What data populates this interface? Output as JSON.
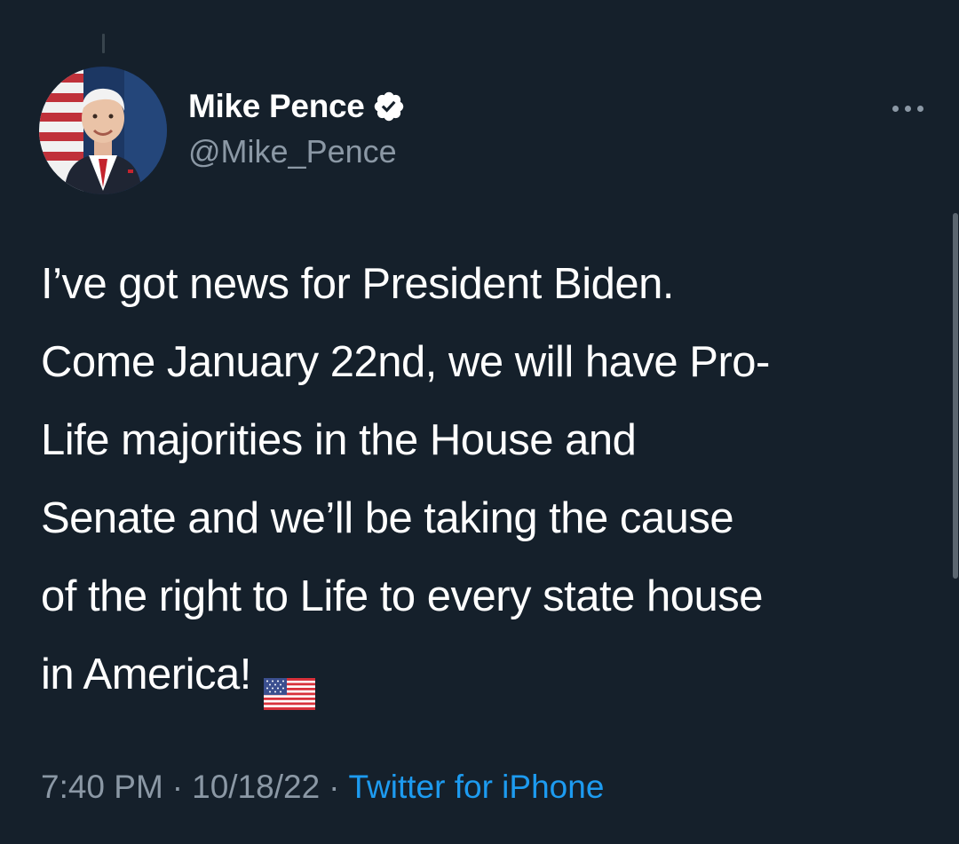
{
  "author": {
    "display_name": "Mike Pence",
    "handle": "@Mike_Pence",
    "verified": true
  },
  "tweet": {
    "text_lines": [
      "I’ve got news for President Biden.",
      "Come January 22nd, we will have Pro-",
      "Life majorities in the House and",
      "Senate and we’ll be taking the cause",
      "of the right to Life to every state house",
      "in America!"
    ],
    "time": "7:40 PM",
    "date": "10/18/22",
    "separator": "·",
    "source": "Twitter for iPhone"
  },
  "icons": {
    "more": "more-horizontal-icon",
    "verified": "verified-badge-icon",
    "emoji": "us-flag-emoji"
  },
  "colors": {
    "background": "#15202b",
    "primary_text": "#ffffff",
    "secondary_text": "#8b98a5",
    "link": "#1d9bf0"
  }
}
